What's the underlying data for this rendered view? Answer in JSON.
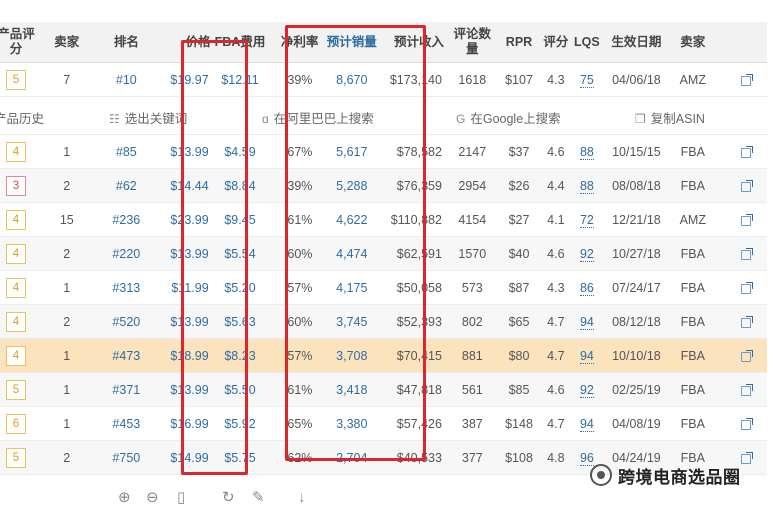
{
  "headers": [
    "产品评分",
    "卖家",
    "排名",
    "价格",
    "FBA费用",
    "净利率",
    "预计销量",
    "预计收入",
    "评论数量",
    "RPR",
    "评分",
    "LQS",
    "生效日期",
    "卖家"
  ],
  "rows": [
    {
      "score": "5",
      "sellers": "7",
      "rank": "#10",
      "price": "$19.97",
      "fba": "$12.11",
      "margin": "39%",
      "sales": "8,670",
      "revenue": "$173,140",
      "reviews": "1618",
      "rpr": "$107",
      "rating": "4.3",
      "lqs": "75",
      "date": "04/06/18",
      "seller": "AMZ"
    },
    {
      "score": "4",
      "sellers": "1",
      "rank": "#85",
      "price": "$13.99",
      "fba": "$4.59",
      "margin": "67%",
      "sales": "5,617",
      "revenue": "$78,582",
      "reviews": "2147",
      "rpr": "$37",
      "rating": "4.6",
      "lqs": "88",
      "date": "10/15/15",
      "seller": "FBA"
    },
    {
      "score": "3",
      "sellers": "2",
      "rank": "#62",
      "price": "$14.44",
      "fba": "$8.84",
      "margin": "39%",
      "sales": "5,288",
      "revenue": "$76,359",
      "reviews": "2954",
      "rpr": "$26",
      "rating": "4.4",
      "lqs": "88",
      "date": "08/08/18",
      "seller": "FBA"
    },
    {
      "score": "4",
      "sellers": "15",
      "rank": "#236",
      "price": "$23.99",
      "fba": "$9.45",
      "margin": "61%",
      "sales": "4,622",
      "revenue": "$110,882",
      "reviews": "4154",
      "rpr": "$27",
      "rating": "4.1",
      "lqs": "72",
      "date": "12/21/18",
      "seller": "AMZ"
    },
    {
      "score": "4",
      "sellers": "2",
      "rank": "#220",
      "price": "$13.99",
      "fba": "$5.54",
      "margin": "60%",
      "sales": "4,474",
      "revenue": "$62,591",
      "reviews": "1570",
      "rpr": "$40",
      "rating": "4.6",
      "lqs": "92",
      "date": "10/27/18",
      "seller": "FBA"
    },
    {
      "score": "4",
      "sellers": "1",
      "rank": "#313",
      "price": "$11.99",
      "fba": "$5.20",
      "margin": "57%",
      "sales": "4,175",
      "revenue": "$50,058",
      "reviews": "573",
      "rpr": "$87",
      "rating": "4.3",
      "lqs": "86",
      "date": "07/24/17",
      "seller": "FBA"
    },
    {
      "score": "4",
      "sellers": "2",
      "rank": "#520",
      "price": "$13.99",
      "fba": "$5.63",
      "margin": "60%",
      "sales": "3,745",
      "revenue": "$52,393",
      "reviews": "802",
      "rpr": "$65",
      "rating": "4.7",
      "lqs": "94",
      "date": "08/12/18",
      "seller": "FBA"
    },
    {
      "score": "4",
      "sellers": "1",
      "rank": "#473",
      "price": "$18.99",
      "fba": "$8.23",
      "margin": "57%",
      "sales": "3,708",
      "revenue": "$70,415",
      "reviews": "881",
      "rpr": "$80",
      "rating": "4.7",
      "lqs": "94",
      "date": "10/10/18",
      "seller": "FBA"
    },
    {
      "score": "5",
      "sellers": "1",
      "rank": "#371",
      "price": "$13.99",
      "fba": "$5.50",
      "margin": "61%",
      "sales": "3,418",
      "revenue": "$47,818",
      "reviews": "561",
      "rpr": "$85",
      "rating": "4.6",
      "lqs": "92",
      "date": "02/25/19",
      "seller": "FBA"
    },
    {
      "score": "6",
      "sellers": "1",
      "rank": "#453",
      "price": "$16.99",
      "fba": "$5.92",
      "margin": "65%",
      "sales": "3,380",
      "revenue": "$57,426",
      "reviews": "387",
      "rpr": "$148",
      "rating": "4.7",
      "lqs": "94",
      "date": "04/08/19",
      "seller": "FBA"
    },
    {
      "score": "5",
      "sellers": "2",
      "rank": "#750",
      "price": "$14.99",
      "fba": "$5.75",
      "margin": "62%",
      "sales": "2,704",
      "revenue": "$40,533",
      "reviews": "377",
      "rpr": "$108",
      "rating": "4.8",
      "lqs": "96",
      "date": "04/24/19",
      "seller": "FBA"
    }
  ],
  "actions": {
    "history": "产品历史",
    "keywords": "选出关键词",
    "alibaba": "在阿里巴巴上搜索",
    "google": "在Google上搜索",
    "copy_asin": "复制ASIN"
  },
  "watermark": "跨境电商选品圈",
  "highlight_row": 7,
  "colors": {
    "accent": "#2e6da4",
    "highlight": "#fbe3bd",
    "annotation": "#d9272e"
  }
}
